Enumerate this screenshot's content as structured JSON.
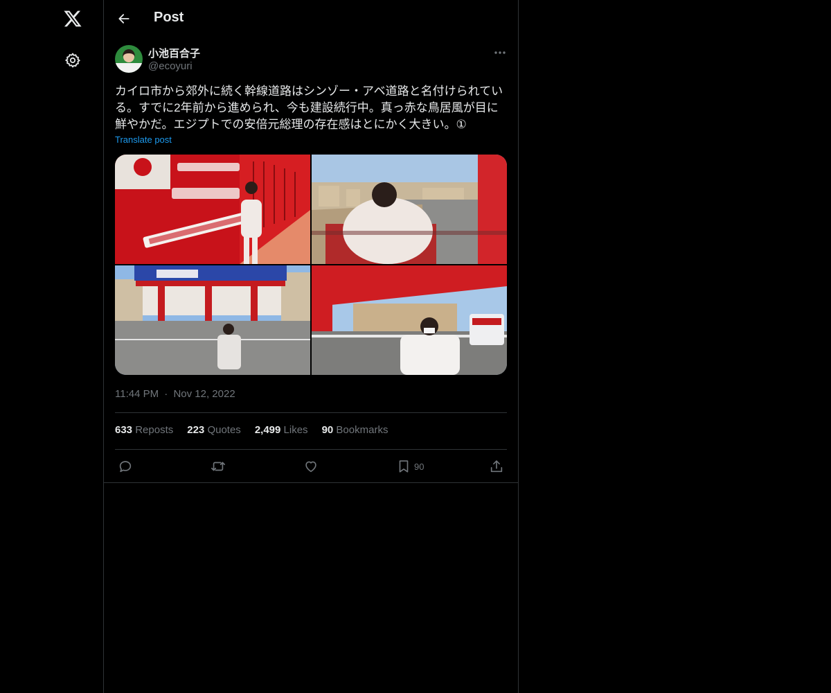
{
  "nav": {
    "logo_icon": "x-logo-icon",
    "settings_icon": "gear-icon"
  },
  "header": {
    "back_icon": "arrow-left-icon",
    "title": "Post"
  },
  "post": {
    "author": {
      "name": "小池百合子",
      "handle": "@ecoyuri",
      "avatar_icon": "avatar"
    },
    "more_icon": "ellipsis-icon",
    "text": "カイロ市から郊外に続く幹線道路はシンゾー・アベ道路と名付けられている。すでに2年前から進められ、今も建設続行中。真っ赤な鳥居風が目に鮮やかだ。エジプトでの安倍元総理の存在感はとにかく大きい。①",
    "translate_label": "Translate post",
    "time": "11:44 PM",
    "separator": "·",
    "date": "Nov 12, 2022",
    "stats": {
      "reposts_count": "633",
      "reposts_label": "Reposts",
      "quotes_count": "223",
      "quotes_label": "Quotes",
      "likes_count": "2,499",
      "likes_label": "Likes",
      "bookmarks_count": "90",
      "bookmarks_label": "Bookmarks"
    },
    "actions": {
      "bookmark_count": "90"
    }
  },
  "colors": {
    "background": "#000000",
    "text": "#e7e9ea",
    "muted": "#71767b",
    "link": "#1d9bf0",
    "border": "#2f3336"
  }
}
